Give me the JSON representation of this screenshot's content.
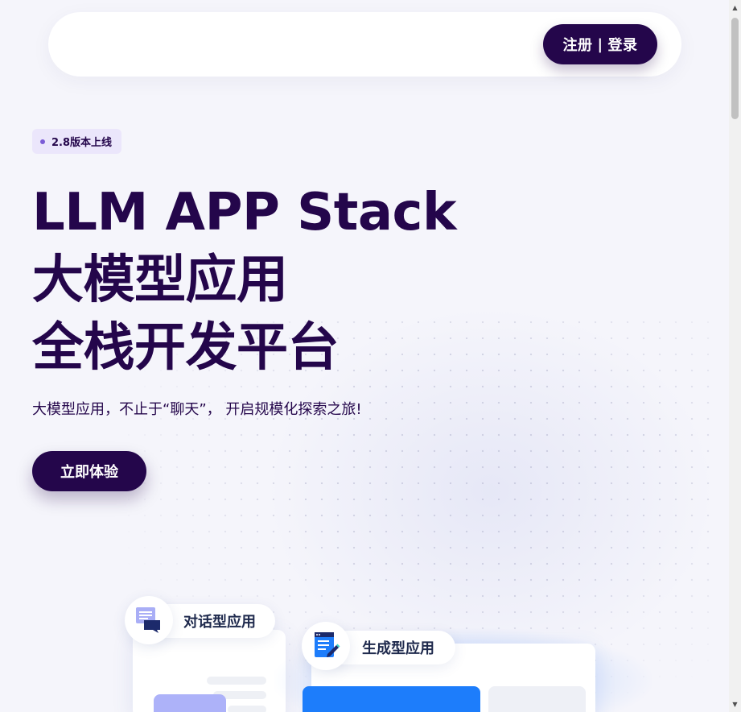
{
  "header": {
    "auth_button": {
      "register": "注册",
      "separator": "|",
      "login": "登录"
    }
  },
  "hero": {
    "badge": "2.8版本上线",
    "title_lines": [
      "LLM APP Stack",
      "大模型应用",
      "全栈开发平台"
    ],
    "subtitle": "大模型应用，不止于“聊天”， 开启规模化探索之旅!",
    "cta": "立即体验"
  },
  "preview": {
    "chat_app_label": "对话型应用",
    "generative_app_label": "生成型应用",
    "chat_icon": "chat-bubbles-icon",
    "generative_icon": "document-edit-icon"
  },
  "colors": {
    "primary": "#24064b",
    "background": "#f5f5fb",
    "badge_bg": "#ebe6fb",
    "accent_blue": "#1d7dfb",
    "accent_lavender": "#adb2f9"
  }
}
